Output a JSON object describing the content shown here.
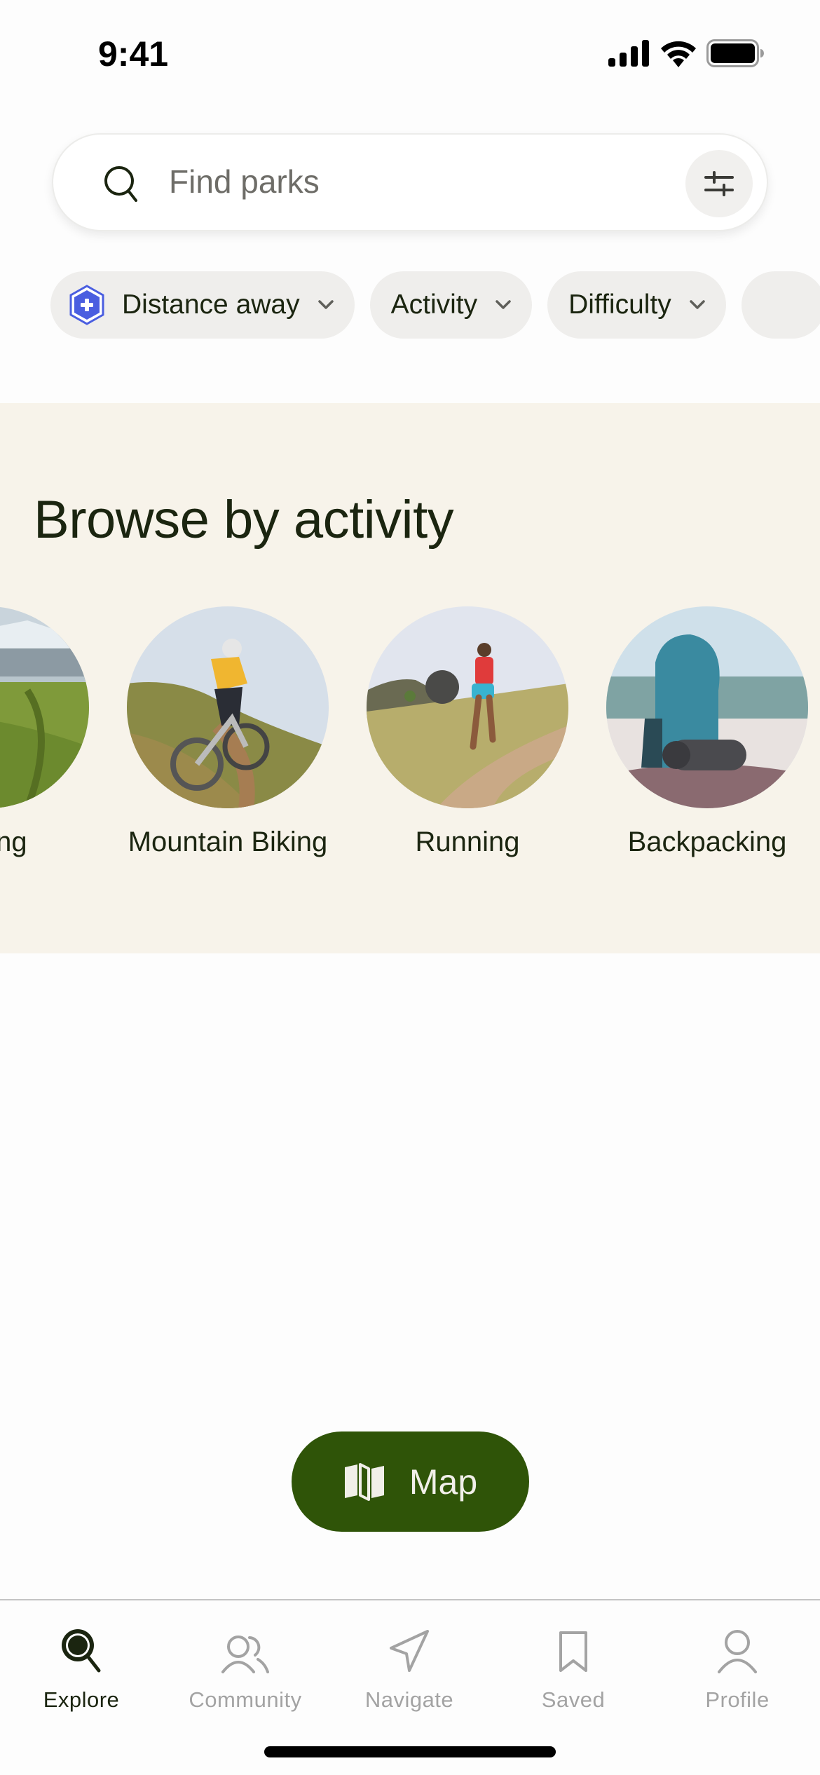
{
  "status_bar": {
    "time": "9:41"
  },
  "search": {
    "placeholder": "Find parks"
  },
  "filter_chips": [
    {
      "label": "Distance away",
      "icon": "hexagon-plus-badge-icon",
      "badge_color": "#4a5ee0"
    },
    {
      "label": "Activity"
    },
    {
      "label": "Difficulty"
    },
    {
      "label": ""
    }
  ],
  "browse": {
    "title": "Browse by activity",
    "activities": [
      {
        "label": "Hiking",
        "visible_label": "ng"
      },
      {
        "label": "Mountain Biking"
      },
      {
        "label": "Running"
      },
      {
        "label": "Backpacking"
      }
    ]
  },
  "map_button": {
    "label": "Map",
    "icon": "map-icon"
  },
  "tabbar": {
    "items": [
      {
        "label": "Explore",
        "icon": "explore-search-icon",
        "active": true
      },
      {
        "label": "Community",
        "icon": "community-icon",
        "active": false
      },
      {
        "label": "Navigate",
        "icon": "navigate-icon",
        "active": false
      },
      {
        "label": "Saved",
        "icon": "bookmark-icon",
        "active": false
      },
      {
        "label": "Profile",
        "icon": "profile-icon",
        "active": false
      }
    ]
  },
  "colors": {
    "brand_green": "#2f5408",
    "text_dark": "#1b2510",
    "section_bg": "#f7f3ea",
    "chip_bg": "#efeeec",
    "inactive_tab": "#a3a3a3"
  }
}
